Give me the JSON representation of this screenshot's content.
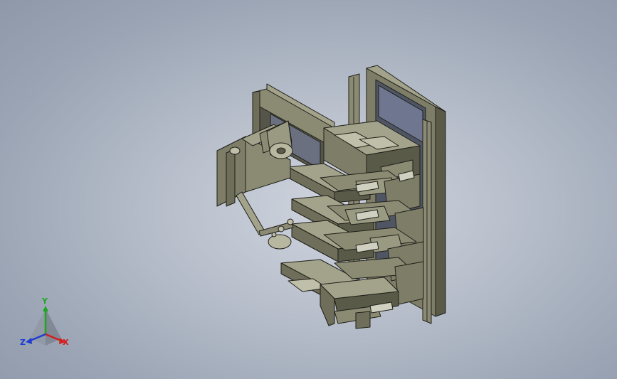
{
  "viewport": {
    "background_center": "#cfd4de",
    "background_edge": "#8e98a9"
  },
  "model": {
    "metal_color": "#85856f",
    "metal_light": "#a3a38b",
    "metal_dark": "#5a5a48",
    "edge_color": "#1e1e18"
  },
  "triad": {
    "x_label": "X",
    "y_label": "Y",
    "z_label": "Z",
    "x_color": "#d21e1e",
    "y_color": "#1fa51f",
    "z_color": "#1e3cd2"
  }
}
